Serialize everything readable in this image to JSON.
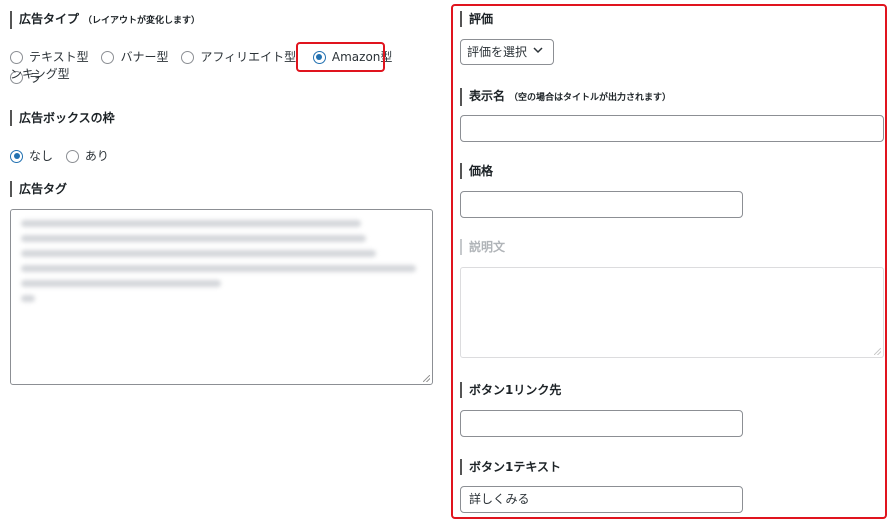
{
  "left": {
    "ad_type": {
      "title": "広告タイプ",
      "note": "（レイアウトが変化します）",
      "options": [
        {
          "label": "テキスト型",
          "checked": false
        },
        {
          "label": "バナー型",
          "checked": false
        },
        {
          "label": "アフィリエイト型",
          "checked": false
        },
        {
          "label": "Amazon型",
          "checked": true
        },
        {
          "label": "ランキング型",
          "checked": false
        }
      ],
      "rank_label_part1": "ラ",
      "rank_label_part2": "ンキング型"
    },
    "ad_box_border": {
      "title": "広告ボックスの枠",
      "options": [
        {
          "label": "なし",
          "checked": true
        },
        {
          "label": "あり",
          "checked": false
        }
      ]
    },
    "ad_tag": {
      "title": "広告タグ"
    }
  },
  "right": {
    "rating": {
      "title": "評価",
      "select_value": "評価を選択"
    },
    "display_name": {
      "title": "表示名",
      "note": "（空の場合はタイトルが出力されます）",
      "value": ""
    },
    "price": {
      "title": "価格",
      "value": ""
    },
    "description": {
      "title": "説明文",
      "value": ""
    },
    "button1_link": {
      "title": "ボタン1リンク先",
      "value": ""
    },
    "button1_text": {
      "title": "ボタン1テキスト",
      "value": "詳しくみる"
    }
  },
  "colors": {
    "highlight": "#e0141e",
    "radio_checked": "#2271b1"
  }
}
